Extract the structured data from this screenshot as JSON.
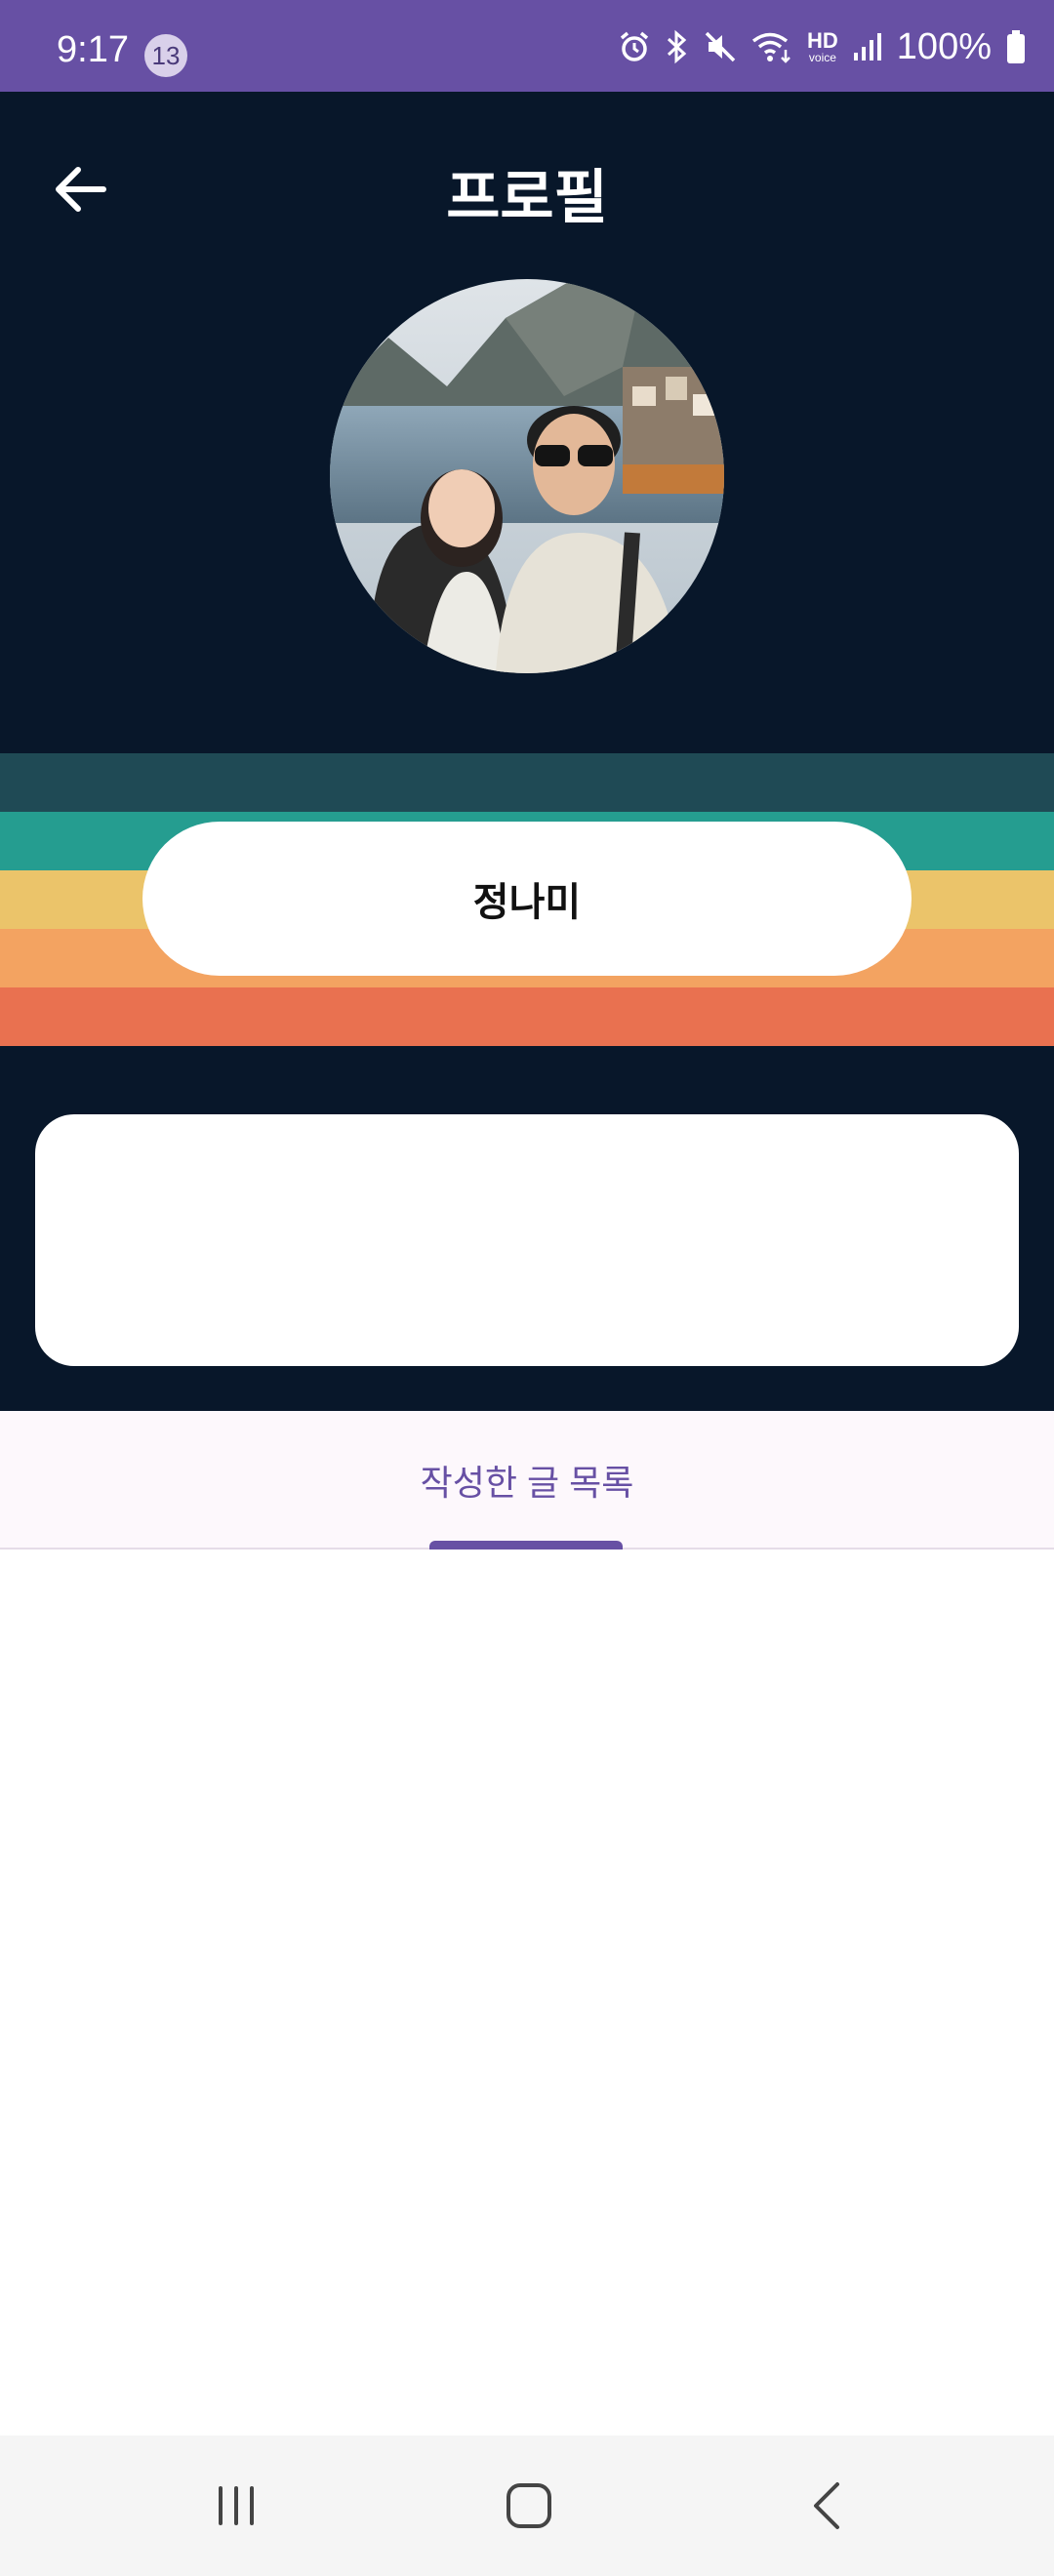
{
  "status_bar": {
    "time": "9:17",
    "notification_count": "13",
    "battery": "100%",
    "hd_label": "HD",
    "voice_label": "voice",
    "icons": [
      "alarm-icon",
      "bluetooth-icon",
      "mute-icon",
      "wifi-icon",
      "hd-voice-icon",
      "signal-icon",
      "battery-icon"
    ],
    "background": "#6750a4"
  },
  "header": {
    "title": "프로필",
    "back_icon": "arrow-left-icon",
    "background": "#08172a"
  },
  "profile": {
    "name": "정나미",
    "stripe_colors": [
      "#1f4a55",
      "#259d90",
      "#ebc46a",
      "#f3a361",
      "#e97150"
    ]
  },
  "tabs": {
    "items": [
      {
        "label": "작성한 글 목록",
        "selected": true
      }
    ],
    "accent": "#6750a4"
  },
  "nav_bar": {
    "icons": [
      "recent-apps-icon",
      "home-icon",
      "back-icon"
    ]
  }
}
